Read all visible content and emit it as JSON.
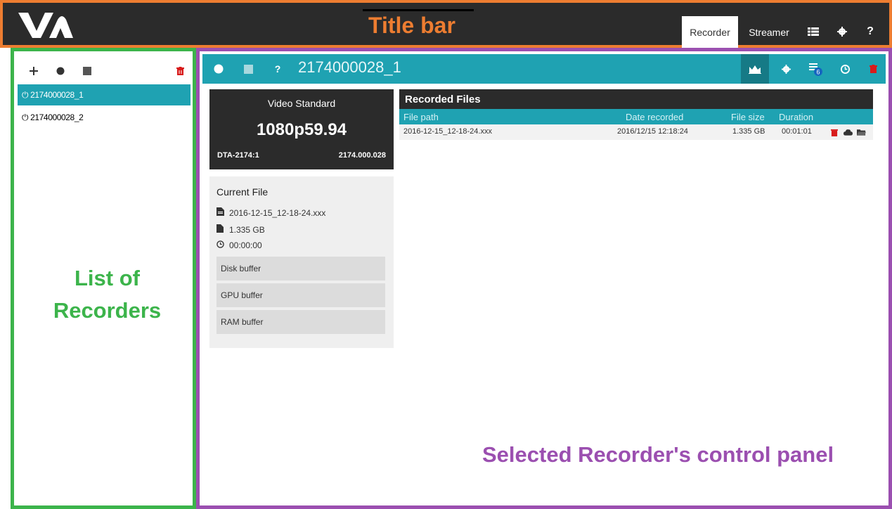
{
  "annotations": {
    "title_bar": "Title bar",
    "list": [
      "List of",
      "Recorders"
    ],
    "control_panel": "Selected Recorder's control panel"
  },
  "titlebar": {
    "tabs": [
      {
        "label": "Recorder",
        "active": true
      },
      {
        "label": "Streamer",
        "active": false
      }
    ],
    "icons": [
      "list-icon",
      "gear-icon",
      "help-icon"
    ],
    "help_glyph": "?"
  },
  "recorders": {
    "toolbar_icons": [
      "add-icon",
      "record-icon",
      "stop-icon",
      "trash-icon"
    ],
    "items": [
      {
        "label": "2174000028_1",
        "selected": true
      },
      {
        "label": "2174000028_2",
        "selected": false
      }
    ]
  },
  "control": {
    "title": "2174000028_1",
    "help_glyph": "?",
    "badge_count": "6",
    "video": {
      "label": "Video Standard",
      "value": "1080p59.94",
      "model": "DTA-2174:1",
      "serial": "2174.000.028"
    },
    "current_file": {
      "title": "Current File",
      "name": "2016-12-15_12-18-24.xxx",
      "size": "1.335 GB",
      "time": "00:00:00",
      "buffers": [
        "Disk buffer",
        "GPU buffer",
        "RAM buffer"
      ]
    },
    "recorded_files": {
      "title": "Recorded Files",
      "columns": [
        "File path",
        "Date recorded",
        "File size",
        "Duration"
      ],
      "rows": [
        {
          "path": "2016-12-15_12-18-24.xxx",
          "date": "2016/12/15 12:18:24",
          "size": "1.335 GB",
          "duration": "00:01:01"
        }
      ]
    }
  },
  "colors": {
    "accent": "#1fa2b2",
    "title_frame": "#ed7d31",
    "list_frame": "#3cb44b",
    "panel_frame": "#9b4fb0",
    "delete": "#d81b1b",
    "dark": "#2b2b2b"
  }
}
